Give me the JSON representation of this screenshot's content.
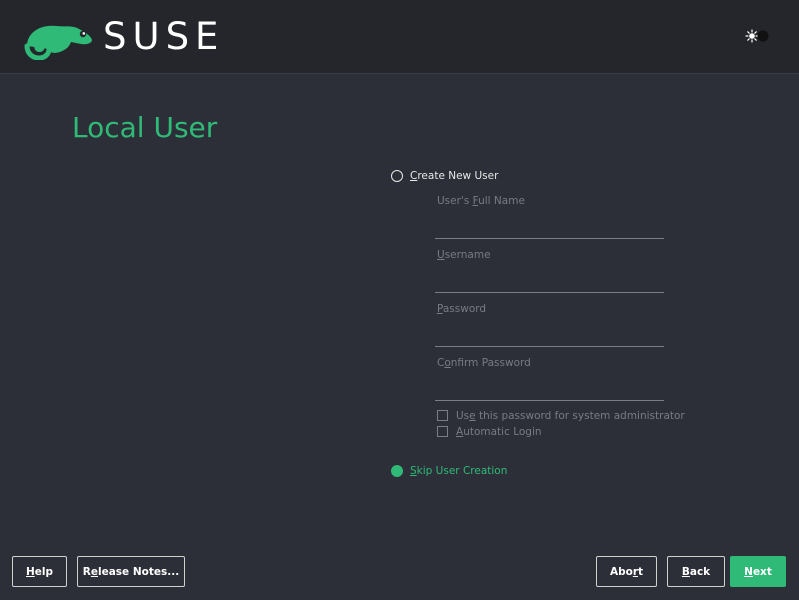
{
  "header": {
    "brand": "SUSE",
    "theme_toggle_icon": "sun-icon"
  },
  "page": {
    "title": "Local User"
  },
  "create_user": {
    "label_prefix": "",
    "label_accel": "C",
    "label_rest": "reate New User",
    "fields": [
      {
        "label_pre": "User's ",
        "label_accel": "F",
        "label_post": "ull Name",
        "value": ""
      },
      {
        "label_pre": "",
        "label_accel": "U",
        "label_post": "sername",
        "value": ""
      },
      {
        "label_pre": "",
        "label_accel": "P",
        "label_post": "assword",
        "value": ""
      },
      {
        "label_pre": "C",
        "label_accel": "o",
        "label_post": "nfirm Password",
        "value": ""
      }
    ],
    "use_admin_pw": {
      "pre": "Us",
      "accel": "e",
      "post": " this password for system administrator",
      "checked": false
    },
    "auto_login": {
      "pre": "",
      "accel": "A",
      "post": "utomatic Login",
      "checked": false
    }
  },
  "skip_user": {
    "pre": "",
    "accel": "S",
    "post": "kip User Creation",
    "selected": true
  },
  "footer": {
    "help": {
      "pre": "",
      "accel": "H",
      "post": "elp"
    },
    "release_notes": {
      "pre": "R",
      "accel": "e",
      "post": "lease Notes..."
    },
    "abort": {
      "pre": "Abo",
      "accel": "r",
      "post": "t"
    },
    "back": {
      "pre": "",
      "accel": "B",
      "post": "ack"
    },
    "next": {
      "pre": "",
      "accel": "N",
      "post": "ext"
    }
  },
  "colors": {
    "accent": "#30ba78",
    "background": "#2c2f37",
    "header": "#24262c"
  }
}
